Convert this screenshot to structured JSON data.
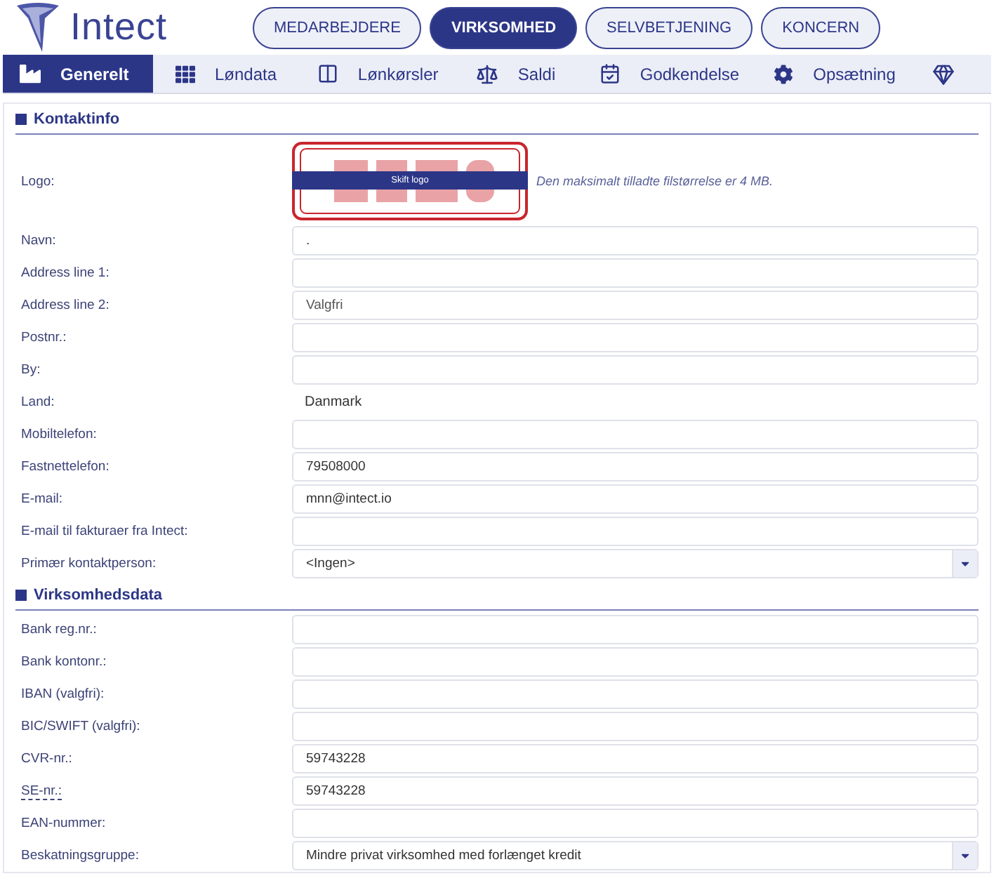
{
  "brand": {
    "name": "Intect"
  },
  "top_nav": [
    {
      "label": "MEDARBEJDERE",
      "selected": false
    },
    {
      "label": "VIRKSOMHED",
      "selected": true
    },
    {
      "label": "SELVBETJENING",
      "selected": false
    },
    {
      "label": "KONCERN",
      "selected": false
    }
  ],
  "tabs": [
    {
      "label": "Generelt",
      "selected": true
    },
    {
      "label": "Løndata",
      "selected": false
    },
    {
      "label": "Lønkørsler",
      "selected": false
    },
    {
      "label": "Saldi",
      "selected": false
    },
    {
      "label": "Godkendelse",
      "selected": false
    },
    {
      "label": "Opsætning",
      "selected": false
    },
    {
      "selected": false
    }
  ],
  "sections": [
    {
      "title": "Kontaktinfo",
      "logo": {
        "label": "Logo:",
        "button": "Skift logo",
        "note": "Den maksimalt tilladte filstørrelse er 4 MB."
      },
      "fields": [
        {
          "label": "Navn:",
          "kind": "input",
          "value": "."
        },
        {
          "label": "Address line 1:",
          "kind": "input"
        },
        {
          "label": "Address line 2:",
          "kind": "input",
          "placeholder": "Valgfri"
        },
        {
          "label": "Postnr.:",
          "kind": "input"
        },
        {
          "label": "By:",
          "kind": "input"
        },
        {
          "label": "Land:",
          "kind": "text",
          "value": "Danmark"
        },
        {
          "label": "Mobiltelefon:",
          "kind": "input"
        },
        {
          "label": "Fastnettelefon:",
          "kind": "input",
          "value": "79508000"
        },
        {
          "label": "E-mail:",
          "kind": "input",
          "value": "mnn@intect.io"
        },
        {
          "label": "E-mail til fakturaer fra Intect:",
          "kind": "input"
        },
        {
          "label": "Primær kontaktperson:",
          "kind": "select",
          "value": "<Ingen>"
        }
      ]
    },
    {
      "title": "Virksomhedsdata",
      "fields": [
        {
          "label": "Bank reg.nr.:",
          "kind": "input"
        },
        {
          "label": "Bank kontonr.:",
          "kind": "input"
        },
        {
          "label": "IBAN (valgfri):",
          "kind": "input"
        },
        {
          "label": "BIC/SWIFT (valgfri):",
          "kind": "input"
        },
        {
          "label": "CVR-nr.:",
          "kind": "input",
          "value": "59743228"
        },
        {
          "label": "SE-nr.:",
          "kind": "input",
          "value": "59743228",
          "hint": true
        },
        {
          "label": "EAN-nummer:",
          "kind": "input"
        },
        {
          "label": "Beskatningsgruppe:",
          "kind": "select",
          "value": "Mindre privat virksomhed med forlænget kredit"
        }
      ]
    }
  ]
}
